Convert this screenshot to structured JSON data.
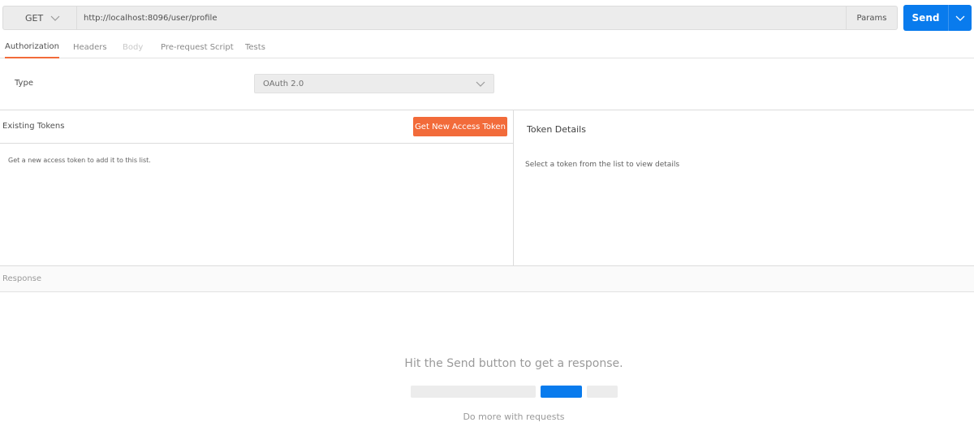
{
  "request": {
    "method": "GET",
    "url": "http://localhost:8096/user/profile",
    "params_label": "Params",
    "send_label": "Send"
  },
  "tabs": [
    {
      "label": "Authorization",
      "state": "active"
    },
    {
      "label": "Headers",
      "state": "normal"
    },
    {
      "label": "Body",
      "state": "disabled"
    },
    {
      "label": "Pre-request Script",
      "state": "normal"
    },
    {
      "label": "Tests",
      "state": "normal"
    }
  ],
  "auth": {
    "type_label": "Type",
    "type_value": "OAuth 2.0"
  },
  "tokens": {
    "existing_title": "Existing Tokens",
    "get_new_label": "Get New Access Token",
    "empty_text": "Get a new access token to add it to this list.",
    "details_title": "Token Details",
    "details_empty": "Select a token from the list to view details"
  },
  "response": {
    "label": "Response",
    "hint": "Hit the Send button to get a response.",
    "more": "Do more with requests"
  },
  "colors": {
    "accent_orange": "#f26b3a",
    "send_blue": "#097bed"
  },
  "icons": {
    "method_dropdown": "chevron-down-icon",
    "type_dropdown": "chevron-down-icon",
    "send_dropdown": "chevron-down-icon"
  }
}
